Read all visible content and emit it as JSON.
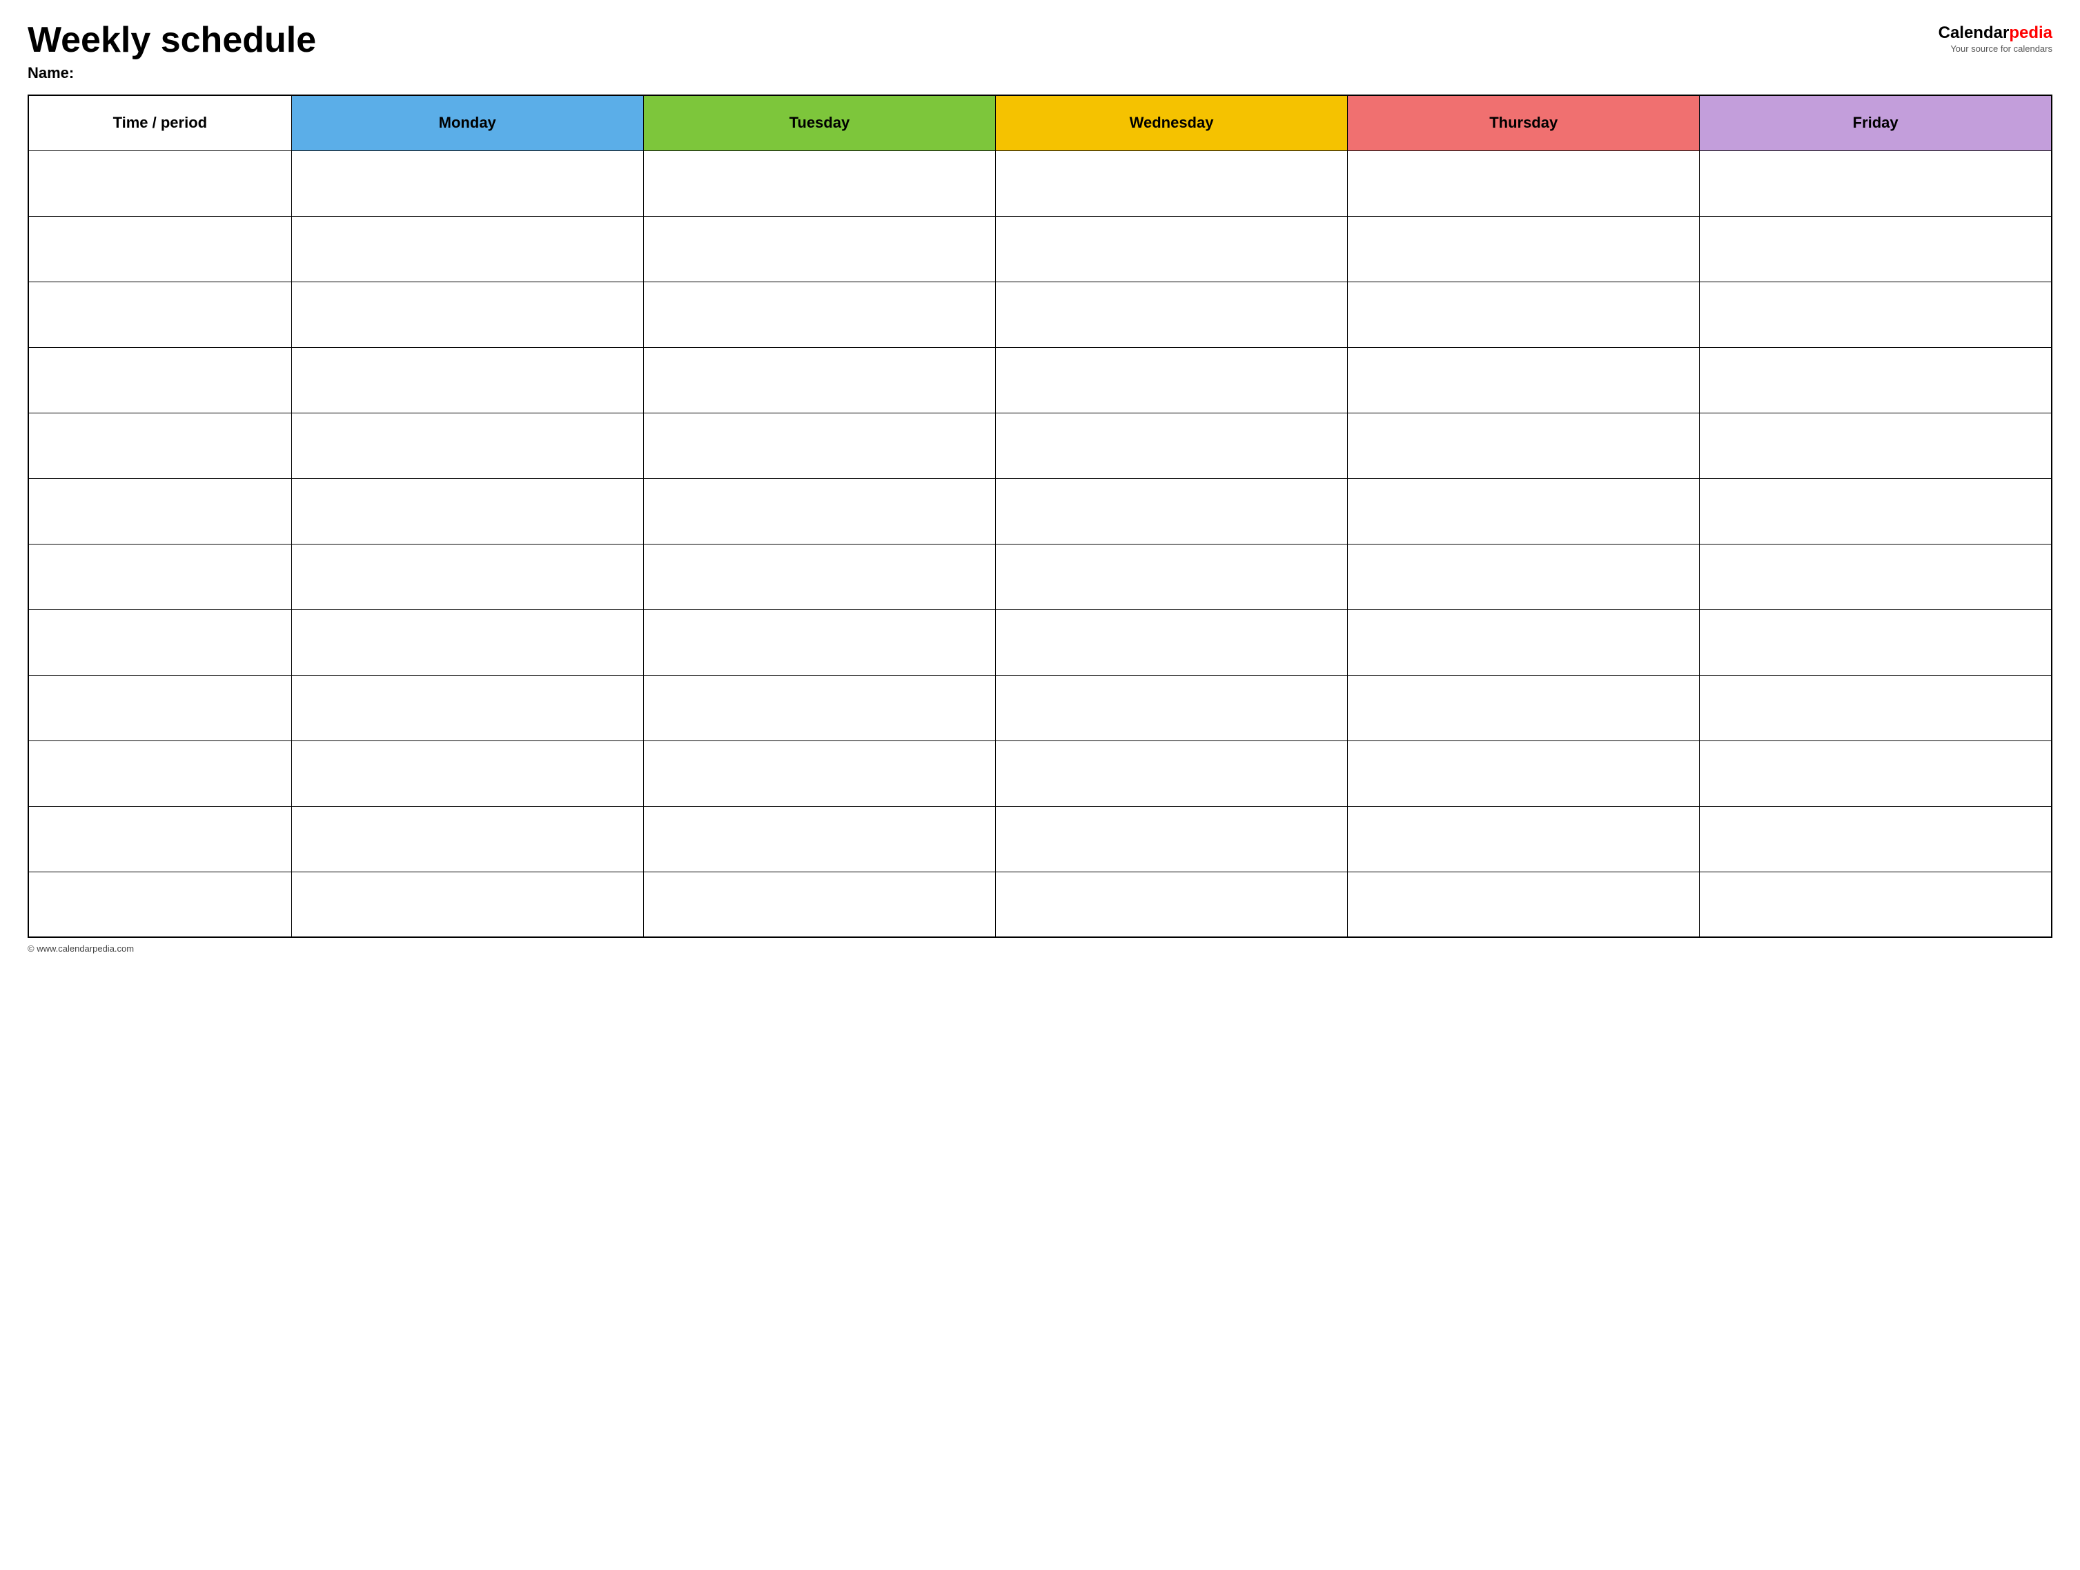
{
  "header": {
    "title": "Weekly schedule",
    "name_label": "Name:",
    "logo": {
      "calendar_text": "Calendar",
      "pedia_text": "pedia",
      "subtitle": "Your source for calendars"
    }
  },
  "table": {
    "columns": [
      {
        "id": "time",
        "label": "Time / period",
        "color": "#ffffff"
      },
      {
        "id": "monday",
        "label": "Monday",
        "color": "#5baee8"
      },
      {
        "id": "tuesday",
        "label": "Tuesday",
        "color": "#7dc63b"
      },
      {
        "id": "wednesday",
        "label": "Wednesday",
        "color": "#f5c200"
      },
      {
        "id": "thursday",
        "label": "Thursday",
        "color": "#f07070"
      },
      {
        "id": "friday",
        "label": "Friday",
        "color": "#c39edb"
      }
    ],
    "rows": 12
  },
  "footer": {
    "url": "© www.calendarpedia.com"
  }
}
